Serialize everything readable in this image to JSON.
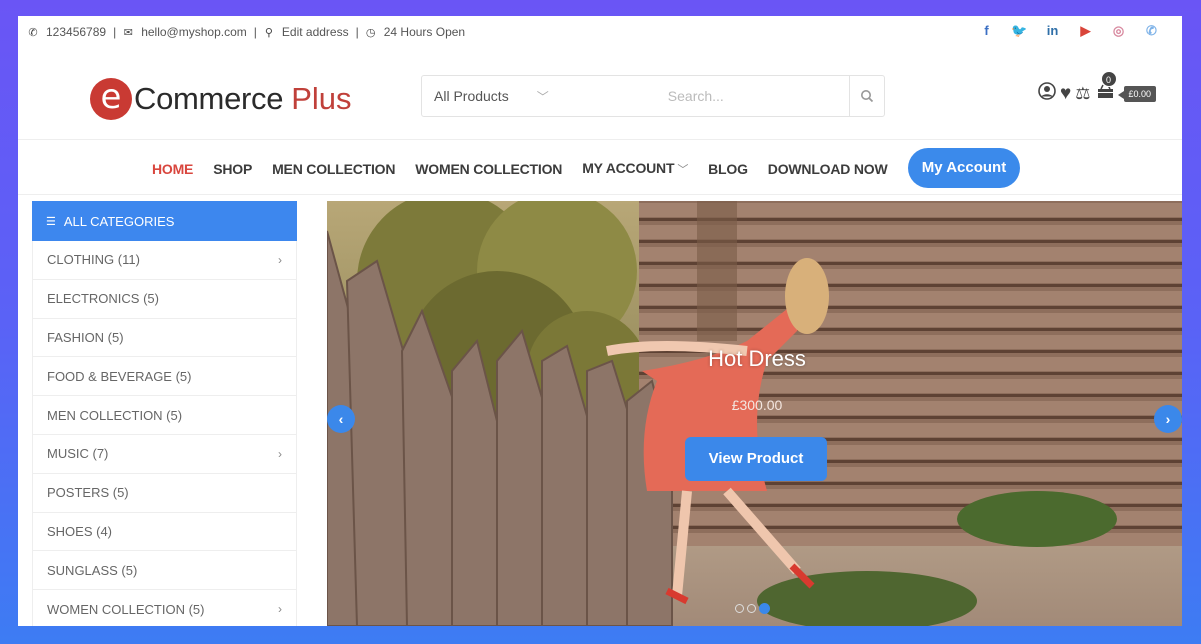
{
  "topbar": {
    "phone": "123456789",
    "email": "hello@myshop.com",
    "address": "Edit address",
    "hours": "24 Hours Open",
    "social": [
      {
        "name": "facebook",
        "glyph": "f",
        "color": "#3b6fc4"
      },
      {
        "name": "twitter",
        "glyph": "🐦",
        "color": "#4a9ee6"
      },
      {
        "name": "linkedin",
        "glyph": "in",
        "color": "#2f6fa8"
      },
      {
        "name": "youtube",
        "glyph": "▶",
        "color": "#d9453a"
      },
      {
        "name": "instagram",
        "glyph": "◎",
        "color": "#d88aa0"
      },
      {
        "name": "whatsapp",
        "glyph": "✆",
        "color": "#7fb3e8"
      }
    ]
  },
  "header": {
    "logo_letter": "e",
    "logo_text": "Commerce",
    "logo_accent": "Plus",
    "search_category": "All Products",
    "search_placeholder": "Search...",
    "cart_count": "0",
    "cart_total": "£0.00"
  },
  "nav": {
    "items": [
      {
        "label": "HOME",
        "active": true
      },
      {
        "label": "SHOP"
      },
      {
        "label": "MEN COLLECTION"
      },
      {
        "label": "WOMEN COLLECTION"
      },
      {
        "label": "MY ACCOUNT",
        "dropdown": true
      },
      {
        "label": "BLOG"
      },
      {
        "label": "DOWNLOAD NOW"
      }
    ],
    "cta": "My Account"
  },
  "sidebar": {
    "title": "ALL CATEGORIES",
    "items": [
      {
        "label": "CLOTHING (11)",
        "has_sub": true
      },
      {
        "label": "ELECTRONICS (5)"
      },
      {
        "label": "FASHION (5)"
      },
      {
        "label": "FOOD & BEVERAGE (5)"
      },
      {
        "label": "MEN COLLECTION (5)"
      },
      {
        "label": "MUSIC (7)",
        "has_sub": true
      },
      {
        "label": "POSTERS (5)"
      },
      {
        "label": "SHOES (4)"
      },
      {
        "label": "SUNGLASS (5)"
      },
      {
        "label": "WOMEN COLLECTION (5)",
        "has_sub": true
      }
    ]
  },
  "slider": {
    "title": "Hot Dress",
    "price": "£300.00",
    "button": "View Product",
    "prev": "‹",
    "next": "›",
    "slide_count": 3,
    "active_slide": 3
  },
  "colors": {
    "accent": "#3b88ea",
    "brand_red": "#c93a33",
    "nav_active": "#d9463e"
  }
}
